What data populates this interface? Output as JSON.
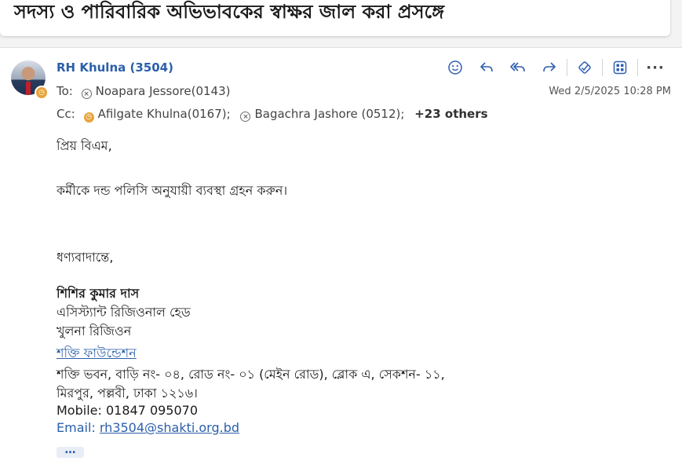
{
  "subject": "সদস্য ও পারিবারিক অভিভাবকের স্বাক্ষর জাল করা প্রসঙ্গে",
  "message": {
    "sender": "RH Khulna (3504)",
    "to_label": "To:",
    "to": [
      "Noapara Jessore(0143)"
    ],
    "cc_label": "Cc:",
    "cc": [
      "Afilgate Khulna(0167);",
      "Bagachra Jashore (0512);"
    ],
    "cc_more": "+23 others",
    "date": "Wed 2/5/2025 10:28 PM",
    "toolbar_icons": [
      "emoji-icon",
      "reply-icon",
      "reply-all-icon",
      "forward-icon",
      "immersive-reader-icon",
      "apps-icon",
      "more-icon"
    ]
  },
  "body": {
    "greeting": "প্রিয় বিএম,",
    "line1": "কর্মীকে দন্ড পলিসি অনুযায়ী ব্যবস্থা গ্রহন করুন।",
    "closing": "ধণ্যবাদান্তে,",
    "signature": {
      "name": "শিশির কুমার দাস",
      "title": "এসিস্ট্যান্ট রিজিওনাল হেড",
      "region": "খুলনা রিজিওন",
      "org_link": "শক্তি ফাউন্ডেশন",
      "address1": "শক্তি ভবন, বাড়ি নং- ০৪, রোড নং- ০১ (মেইন রোড), ব্লোক এ, সেকশন- ১১,",
      "address2": "মিরপুর, পল্লবী, ঢাকা ১২১৬।",
      "mobile": "Mobile: 01847 095070",
      "email_label": "Email:",
      "email": "rh3504@shakti.org.bd"
    }
  },
  "colors": {
    "accent": "#2b5fab",
    "away": "#e8a33b"
  }
}
